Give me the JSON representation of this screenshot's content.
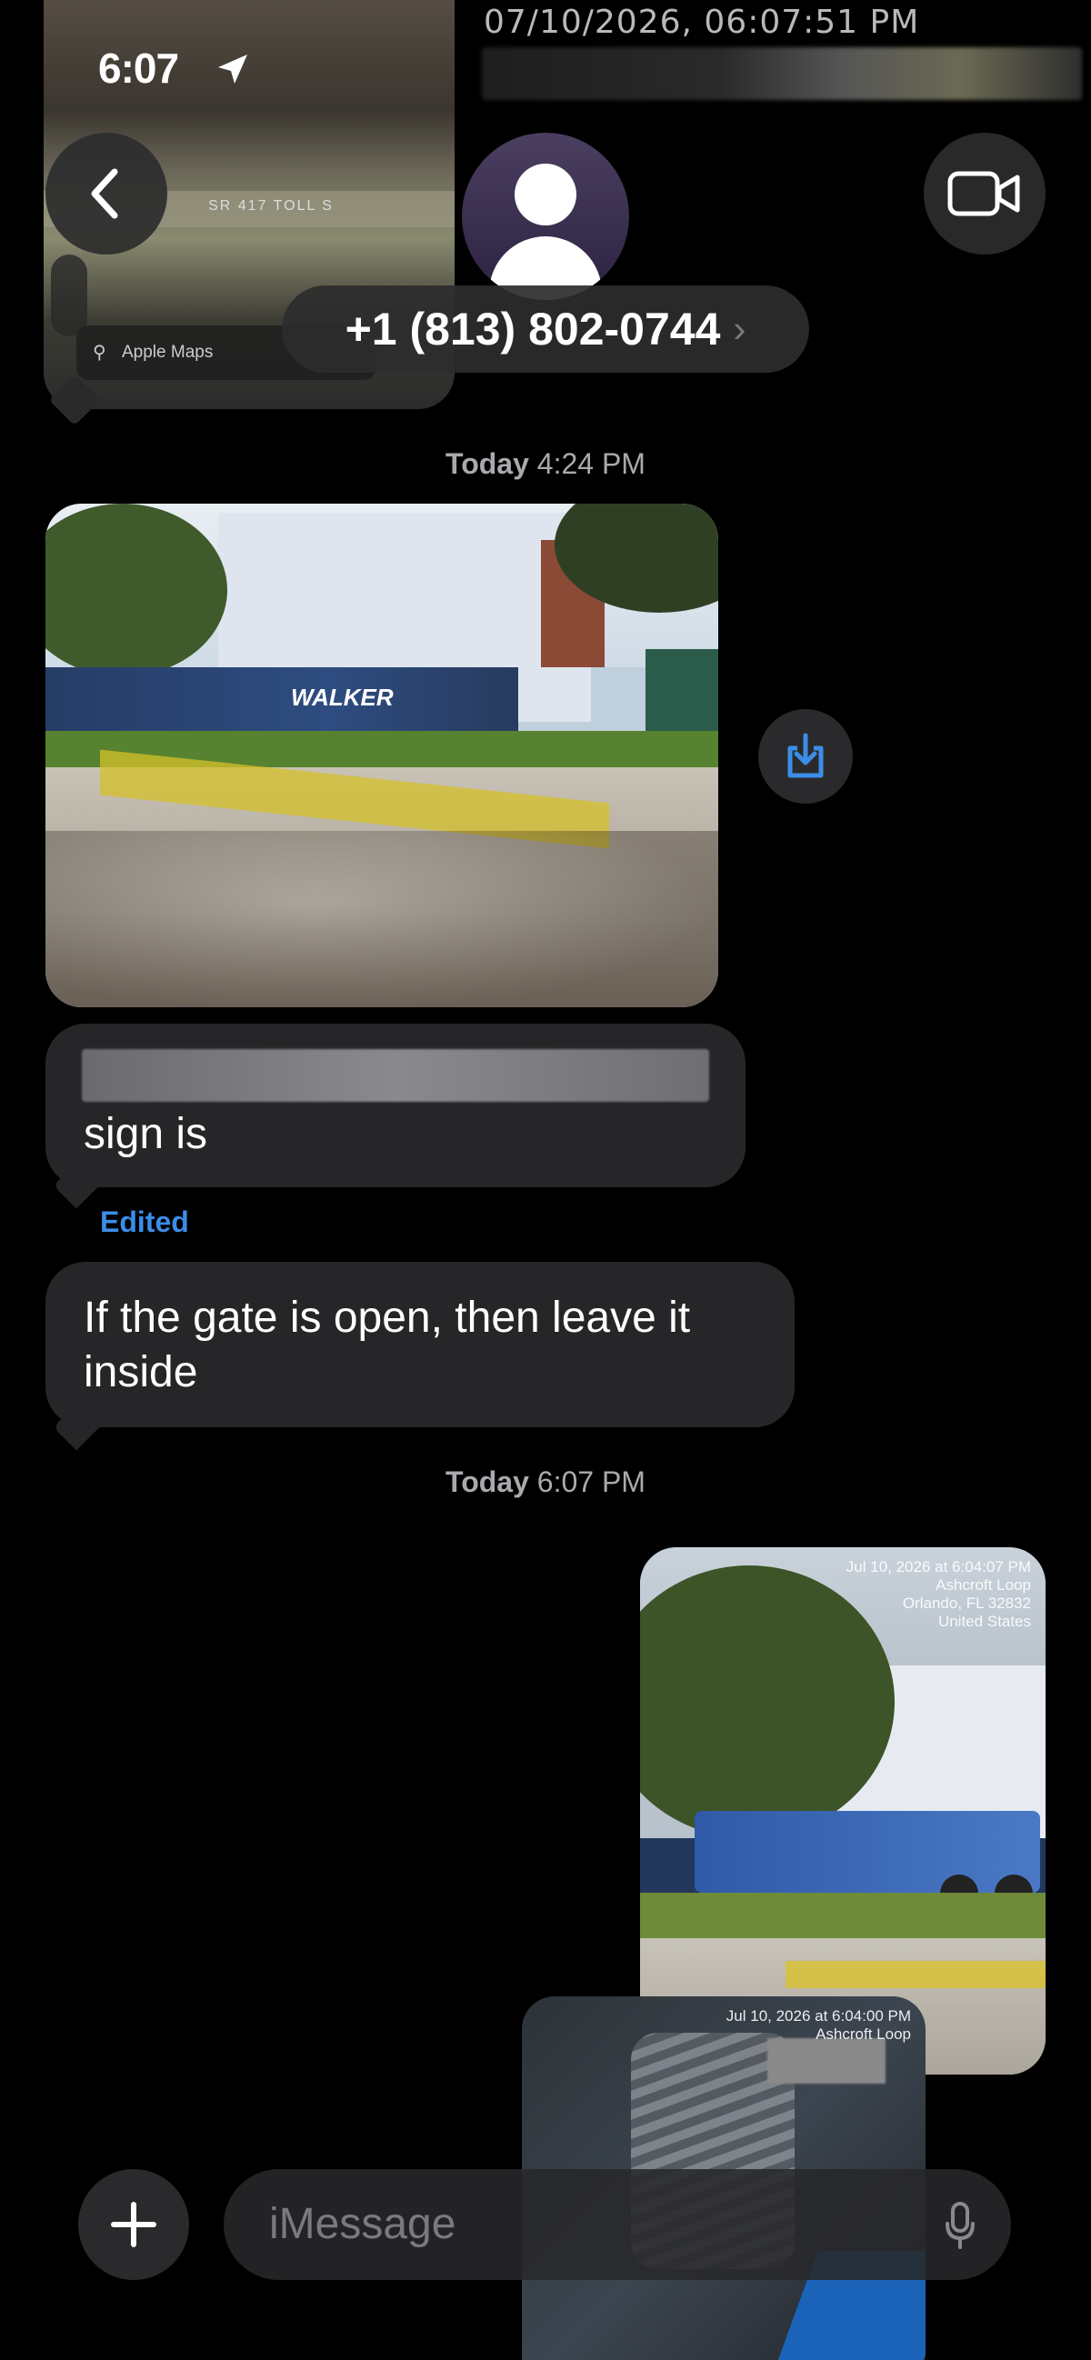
{
  "status_bar": {
    "time": "6:07",
    "capture_stamp": "07/10/2026, 06:07:51 PM"
  },
  "header": {
    "contact": "+1 (813) 802-0744",
    "chevron": "›"
  },
  "map_preview": {
    "road_sign": "SR 417 TOLL S",
    "maps_label": "Apple Maps"
  },
  "thread": {
    "timestamp_1": {
      "day": "Today",
      "time": "4:24 PM"
    },
    "photo_1": {
      "fence_text": "WALKER"
    },
    "message_1": "sign is",
    "message_1_status": "Edited",
    "message_2": "If the gate is open, then leave it inside",
    "timestamp_2": {
      "day": "Today",
      "time": "6:07 PM"
    },
    "photo_2_stamp": "Jul 10, 2026 at 6:04:07 PM\nAshcroft Loop\nOrlando, FL 32832\nUnited States",
    "photo_3_stamp": "Jul 10, 2026 at 6:04:00 PM\nAshcroft Loop"
  },
  "compose": {
    "placeholder": "iMessage"
  },
  "colors": {
    "background": "#000000",
    "bubble_received": "#262628",
    "accent_blue": "#3b8de8"
  },
  "icons": [
    "back-chevron-icon",
    "video-camera-icon",
    "person-icon",
    "location-arrow-icon",
    "save-download-icon",
    "plus-icon",
    "microphone-icon",
    "search-icon"
  ]
}
